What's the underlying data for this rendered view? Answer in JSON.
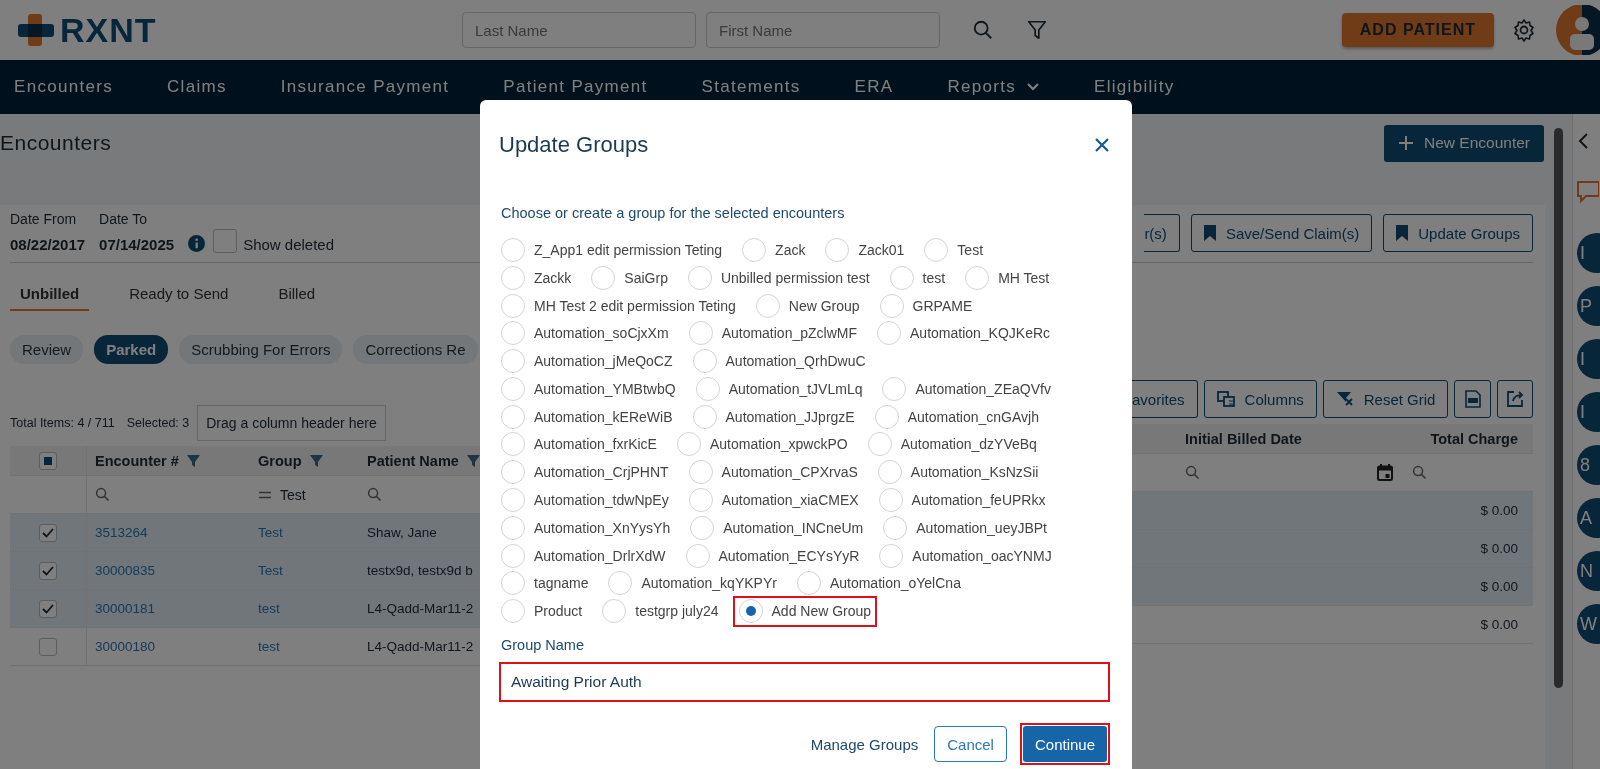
{
  "header": {
    "logo_text": "RXNT",
    "search_fields": [
      {
        "placeholder": "Last Name"
      },
      {
        "placeholder": "First Name"
      }
    ],
    "add_button": "ADD PATIENT"
  },
  "nav": [
    {
      "label": "Encounters",
      "dropdown": false
    },
    {
      "label": "Claims",
      "dropdown": false
    },
    {
      "label": "Insurance Payment",
      "dropdown": false
    },
    {
      "label": "Patient Payment",
      "dropdown": false
    },
    {
      "label": "Statements",
      "dropdown": false
    },
    {
      "label": "ERA",
      "dropdown": false
    },
    {
      "label": "Reports",
      "dropdown": true
    },
    {
      "label": "Eligibility",
      "dropdown": false
    }
  ],
  "page": {
    "title": "Encounters",
    "new_button": "New Encounter"
  },
  "filters": {
    "date_from_label": "Date From",
    "date_to_label": "Date To",
    "date_from": "08/22/2017",
    "date_to": "07/14/2025",
    "show_deleted": {
      "label": "Show deleted",
      "checked": false
    }
  },
  "action_buttons": [
    {
      "kind": "plain",
      "label": "r(s)",
      "cut": true
    },
    {
      "kind": "bookmark",
      "label": "Save/Send Claim(s)",
      "cut": false
    },
    {
      "kind": "bookmark",
      "label": "Update Groups",
      "cut": false
    }
  ],
  "tabs": [
    {
      "label": "Unbilled",
      "selected": true
    },
    {
      "label": "Ready to Send",
      "selected": false
    },
    {
      "label": "Billed",
      "selected": false
    }
  ],
  "chips": [
    {
      "label": "Review",
      "selected": false
    },
    {
      "label": "Parked",
      "selected": true
    },
    {
      "label": "Scrubbing For Errors",
      "selected": false
    },
    {
      "label": "Corrections Re",
      "selected": false
    }
  ],
  "grid": {
    "total": "Total Items: 4 / 711",
    "selected": "Selected: 3",
    "drag_hint": "Drag a column header here",
    "tools": [
      {
        "kind": "text",
        "label": "avorites",
        "cut": true
      },
      {
        "kind": "columns",
        "label": "Columns",
        "cut": false
      },
      {
        "kind": "reset",
        "label": "Reset Grid",
        "cut": false
      },
      {
        "kind": "pdf",
        "cut": false
      },
      {
        "kind": "export",
        "cut": false
      }
    ]
  },
  "table": {
    "select_all_partial": true,
    "columns": [
      {
        "label": "Encounter #",
        "filter": true
      },
      {
        "label": "Group",
        "filter": true
      },
      {
        "label": "Patient Name",
        "filter": true
      },
      {
        "label": "Initial Billed Date",
        "filter": false
      },
      {
        "label": "Total Charge",
        "filter": false
      }
    ],
    "group_filter": "Test",
    "rows": [
      {
        "checked": true,
        "encounter": "3513264",
        "group": "Test",
        "patient": "Shaw, Jane",
        "total_charge": "$ 0.00"
      },
      {
        "checked": true,
        "encounter": "30000835",
        "group": "Test",
        "patient": "testx9d, testx9d b",
        "total_charge": "$ 0.00"
      },
      {
        "checked": true,
        "encounter": "30000181",
        "group": "test",
        "patient": "L4-Qadd-Mar11-2",
        "total_charge": "$ 0.00"
      },
      {
        "checked": false,
        "encounter": "30000180",
        "group": "test",
        "patient": "L4-Qadd-Mar11-2",
        "total_charge": "$ 0.00"
      }
    ]
  },
  "sidebar": {
    "badges": [
      "I",
      "P",
      "I",
      "I",
      "8",
      "A",
      "N",
      "W"
    ]
  },
  "modal": {
    "title": "Update Groups",
    "prompt": "Choose or create a group for the selected encounters",
    "option_rows": [
      [
        {
          "label": "Z_App1 edit permission Teting",
          "selected": false,
          "highlighted": false
        },
        {
          "label": "Zack",
          "selected": false,
          "highlighted": false
        },
        {
          "label": "Zack01",
          "selected": false,
          "highlighted": false
        },
        {
          "label": "Test",
          "selected": false,
          "highlighted": false
        }
      ],
      [
        {
          "label": "Zackk",
          "selected": false,
          "highlighted": false
        },
        {
          "label": "SaiGrp",
          "selected": false,
          "highlighted": false
        },
        {
          "label": "Unbilled permission test",
          "selected": false,
          "highlighted": false
        },
        {
          "label": "test",
          "selected": false,
          "highlighted": false
        },
        {
          "label": "MH Test",
          "selected": false,
          "highlighted": false
        }
      ],
      [
        {
          "label": "MH Test 2 edit permission Teting",
          "selected": false,
          "highlighted": false
        },
        {
          "label": "New Group",
          "selected": false,
          "highlighted": false
        },
        {
          "label": "GRPAME",
          "selected": false,
          "highlighted": false
        }
      ],
      [
        {
          "label": "Automation_soCjxXm",
          "selected": false,
          "highlighted": false
        },
        {
          "label": "Automation_pZclwMF",
          "selected": false,
          "highlighted": false
        },
        {
          "label": "Automation_KQJKeRc",
          "selected": false,
          "highlighted": false
        }
      ],
      [
        {
          "label": "Automation_jMeQoCZ",
          "selected": false,
          "highlighted": false
        },
        {
          "label": "Automation_QrhDwuC",
          "selected": false,
          "highlighted": false
        }
      ],
      [
        {
          "label": "Automation_YMBtwbQ",
          "selected": false,
          "highlighted": false
        },
        {
          "label": "Automation_tJVLmLq",
          "selected": false,
          "highlighted": false
        },
        {
          "label": "Automation_ZEaQVfv",
          "selected": false,
          "highlighted": false
        }
      ],
      [
        {
          "label": "Automation_kEReWiB",
          "selected": false,
          "highlighted": false
        },
        {
          "label": "Automation_JJprgzE",
          "selected": false,
          "highlighted": false
        },
        {
          "label": "Automation_cnGAvjh",
          "selected": false,
          "highlighted": false
        }
      ],
      [
        {
          "label": "Automation_fxrKicE",
          "selected": false,
          "highlighted": false
        },
        {
          "label": "Automation_xpwckPO",
          "selected": false,
          "highlighted": false
        },
        {
          "label": "Automation_dzYVeBq",
          "selected": false,
          "highlighted": false
        }
      ],
      [
        {
          "label": "Automation_CrjPHNT",
          "selected": false,
          "highlighted": false
        },
        {
          "label": "Automation_CPXrvaS",
          "selected": false,
          "highlighted": false
        },
        {
          "label": "Automation_KsNzSii",
          "selected": false,
          "highlighted": false
        }
      ],
      [
        {
          "label": "Automation_tdwNpEy",
          "selected": false,
          "highlighted": false
        },
        {
          "label": "Automation_xiaCMEX",
          "selected": false,
          "highlighted": false
        },
        {
          "label": "Automation_feUPRkx",
          "selected": false,
          "highlighted": false
        }
      ],
      [
        {
          "label": "Automation_XnYysYh",
          "selected": false,
          "highlighted": false
        },
        {
          "label": "Automation_INCneUm",
          "selected": false,
          "highlighted": false
        },
        {
          "label": "Automation_ueyJBPt",
          "selected": false,
          "highlighted": false
        }
      ],
      [
        {
          "label": "Automation_DrlrXdW",
          "selected": false,
          "highlighted": false
        },
        {
          "label": "Automation_ECYsYyR",
          "selected": false,
          "highlighted": false
        },
        {
          "label": "Automation_oacYNMJ",
          "selected": false,
          "highlighted": false
        }
      ],
      [
        {
          "label": "tagname",
          "selected": false,
          "highlighted": false
        },
        {
          "label": "Automation_kqYKPYr",
          "selected": false,
          "highlighted": false
        },
        {
          "label": "Automation_oYelCna",
          "selected": false,
          "highlighted": false
        }
      ],
      [
        {
          "label": "Product",
          "selected": false,
          "highlighted": false
        },
        {
          "label": "testgrp july24",
          "selected": false,
          "highlighted": false
        },
        {
          "label": "Add New Group",
          "selected": true,
          "highlighted": true
        }
      ]
    ],
    "group_name": {
      "label": "Group Name",
      "value": "Awaiting Prior Auth",
      "highlighted": true
    },
    "buttons": [
      {
        "kind": "link",
        "label": "Manage Groups",
        "highlighted": false
      },
      {
        "kind": "outline",
        "label": "Cancel",
        "highlighted": false
      },
      {
        "kind": "primary",
        "label": "Continue",
        "highlighted": true
      }
    ]
  }
}
